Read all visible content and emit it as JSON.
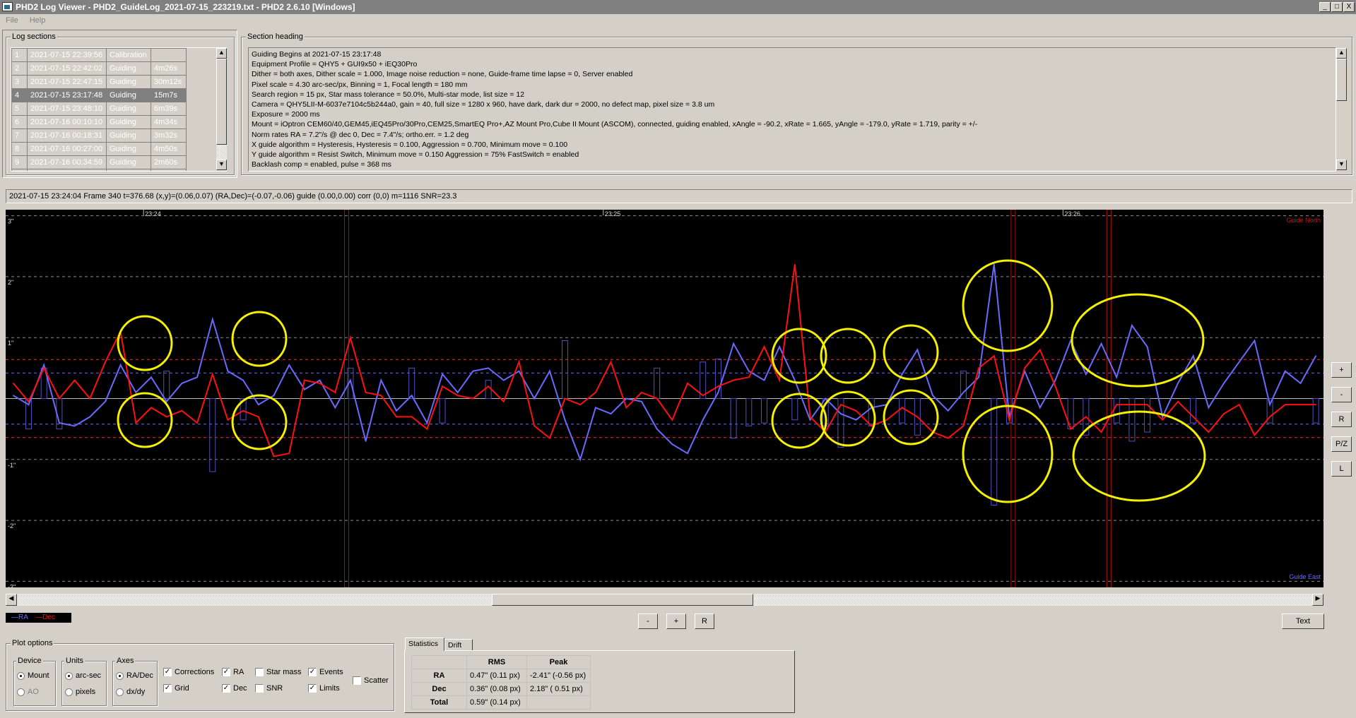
{
  "window": {
    "title": "PHD2 Log Viewer - PHD2_GuideLog_2021-07-15_223219.txt - PHD2 2.6.10 [Windows]",
    "controls": [
      "_",
      "□",
      "X"
    ]
  },
  "menu": [
    "File",
    "Help"
  ],
  "log_sections": {
    "label": "Log sections",
    "selected_index": 3,
    "rows": [
      [
        "1",
        "2021-07-15 22:39:56",
        "Calibration",
        ""
      ],
      [
        "2",
        "2021-07-15 22:42:02",
        "Guiding",
        "4m26s"
      ],
      [
        "3",
        "2021-07-15 22:47:15",
        "Guiding",
        "30m12s"
      ],
      [
        "4",
        "2021-07-15 23:17:48",
        "Guiding",
        "15m7s"
      ],
      [
        "5",
        "2021-07-15 23:48:10",
        "Guiding",
        "6m39s"
      ],
      [
        "6",
        "2021-07-16 00:10:10",
        "Guiding",
        "4m34s"
      ],
      [
        "7",
        "2021-07-16 00:18:31",
        "Guiding",
        "3m32s"
      ],
      [
        "8",
        "2021-07-16 00:27:00",
        "Guiding",
        "4m50s"
      ],
      [
        "9",
        "2021-07-16 00:34:59",
        "Guiding",
        "2m60s"
      ]
    ]
  },
  "section_heading": {
    "label": "Section heading",
    "lines": [
      "Guiding Begins at 2021-07-15 23:17:48",
      "Equipment Profile = QHY5 + GUI9x50 + iEQ30Pro",
      "Dither = both axes, Dither scale = 1.000, Image noise reduction = none, Guide-frame time lapse = 0, Server enabled",
      "Pixel scale = 4.30 arc-sec/px, Binning = 1, Focal length = 180 mm",
      "Search region = 15 px, Star mass tolerance = 50.0%, Multi-star mode, list size = 12",
      " Camera = QHY5LII-M-6037e7104c5b244a0, gain = 40, full size = 1280 x 960, have dark, dark dur = 2000, no defect map, pixel size = 3.8 um",
      "Exposure = 2000 ms",
      "Mount = iOptron CEM60/40,GEM45,iEQ45Pro/30Pro,CEM25,SmartEQ Pro+,AZ Mount Pro,Cube II Mount (ASCOM), connected, guiding enabled, xAngle = -90.2, xRate = 1.665, yAngle = -179.0, yRate = 1.719, parity = +/-",
      "Norm rates RA = 7.2\"/s @ dec 0, Dec = 7.4\"/s; ortho.err. = 1.2 deg",
      "X guide algorithm = Hysteresis, Hysteresis = 0.100, Aggression = 0.700, Minimum move = 0.100",
      "Y guide algorithm = Resist Switch, Minimum move = 0.150 Aggression = 75% FastSwitch = enabled",
      "Backlash comp = enabled, pulse = 368 ms"
    ]
  },
  "status_line": "2021-07-15 23:24:04 Frame 340 t=376.68 (x,y)=(0.06,0.07) (RA,Dec)=(-0.07,-0.06) guide (0.00,0.00) corr (0,0) m=1116 SNR=23.3",
  "chart_data": {
    "type": "line",
    "xlim": [
      "23:23:42",
      "23:26:34"
    ],
    "ylim": [
      -3.1,
      3.1
    ],
    "y_ticks": [
      "3\"",
      "2\"",
      "1\"",
      "0",
      "-1\"",
      "-2\"",
      "-3\""
    ],
    "y_tick_values": [
      3,
      2,
      1,
      0,
      -1,
      -2,
      -3
    ],
    "x_ticks": [
      "23:24",
      "23:25",
      "23:26"
    ],
    "grid": true,
    "top_label": "Guide North",
    "bottom_label": "Guide East",
    "legend": {
      "placement": "bottom-left",
      "entries": [
        "RA",
        "Dec"
      ]
    },
    "limits": {
      "ra": 0.42,
      "dec": 0.64
    },
    "events": [
      "23:24:26.5",
      "23:25:53.5",
      "23:26:06"
    ],
    "sample_interval_note_free": true,
    "x": [
      "23:23:43",
      "23:23:45",
      "23:23:47",
      "23:23:49",
      "23:23:51",
      "23:23:53",
      "23:23:55",
      "23:23:57",
      "23:23:59",
      "23:24:01",
      "23:24:03",
      "23:24:05",
      "23:24:07",
      "23:24:09",
      "23:24:11",
      "23:24:13",
      "23:24:15",
      "23:24:17",
      "23:24:19",
      "23:24:21",
      "23:24:23",
      "23:24:25",
      "23:24:27",
      "23:24:29",
      "23:24:31",
      "23:24:33",
      "23:24:35",
      "23:24:37",
      "23:24:39",
      "23:24:41",
      "23:24:43",
      "23:24:45",
      "23:24:47",
      "23:24:49",
      "23:24:51",
      "23:24:53",
      "23:24:55",
      "23:24:57",
      "23:24:59",
      "23:25:01",
      "23:25:03",
      "23:25:05",
      "23:25:07",
      "23:25:09",
      "23:25:11",
      "23:25:13",
      "23:25:15",
      "23:25:17",
      "23:25:19",
      "23:25:21",
      "23:25:23",
      "23:25:25",
      "23:25:27",
      "23:25:29",
      "23:25:31",
      "23:25:33",
      "23:25:35",
      "23:25:37",
      "23:25:39",
      "23:25:41",
      "23:25:43",
      "23:25:45",
      "23:25:47",
      "23:25:49",
      "23:25:51",
      "23:25:53",
      "23:25:55",
      "23:25:57",
      "23:25:59",
      "23:26:01",
      "23:26:03",
      "23:26:05",
      "23:26:07",
      "23:26:09",
      "23:26:11",
      "23:26:13",
      "23:26:15",
      "23:26:17",
      "23:26:19",
      "23:26:21",
      "23:26:23",
      "23:26:25",
      "23:26:27",
      "23:26:29",
      "23:26:31",
      "23:26:33"
    ],
    "series": [
      {
        "name": "RA",
        "color": "#6a6aff",
        "values": [
          0.05,
          -0.1,
          0.55,
          -0.4,
          -0.45,
          -0.3,
          -0.05,
          0.55,
          0.1,
          0.35,
          -0.05,
          0.25,
          0.35,
          1.3,
          0.45,
          0.3,
          -0.1,
          0.05,
          0.55,
          0.15,
          0.3,
          -0.15,
          0.3,
          -0.7,
          0.3,
          -0.2,
          0.05,
          -0.4,
          0.4,
          0.1,
          0.45,
          0.5,
          0.3,
          0.45,
          0.0,
          0.45,
          -0.35,
          -1.0,
          -0.15,
          -0.25,
          0.0,
          -0.05,
          -0.5,
          -0.75,
          -0.9,
          -0.35,
          0.1,
          0.9,
          0.45,
          0.3,
          0.85,
          0.3,
          -0.35,
          0.0,
          -0.25,
          -0.35,
          -0.15,
          -0.1,
          0.4,
          0.8,
          0.05,
          -0.2,
          0.1,
          0.35,
          2.2,
          -0.3,
          0.45,
          -0.15,
          0.3,
          0.95,
          0.4,
          0.9,
          0.35,
          1.2,
          0.85,
          -0.3,
          0.25,
          0.7,
          -0.15,
          0.25,
          0.6,
          0.95,
          -0.1,
          0.45,
          0.25,
          0.7
        ]
      },
      {
        "name": "Dec",
        "color": "#ff1010",
        "values": [
          0.25,
          -0.05,
          0.5,
          0.0,
          0.3,
          0.0,
          0.6,
          1.1,
          -0.4,
          -0.15,
          -0.3,
          -0.2,
          -0.4,
          0.4,
          -0.35,
          -0.2,
          -0.3,
          -0.95,
          -0.9,
          0.3,
          0.25,
          0.1,
          1.0,
          0.1,
          0.05,
          -0.3,
          -0.3,
          -0.5,
          0.2,
          0.05,
          0.0,
          0.2,
          -0.05,
          0.6,
          -0.45,
          -0.65,
          0.0,
          -0.1,
          0.1,
          0.6,
          -0.15,
          0.1,
          0.0,
          -0.35,
          0.25,
          0.05,
          0.2,
          0.3,
          0.35,
          0.85,
          0.3,
          2.2,
          -0.3,
          -0.55,
          -0.1,
          -0.2,
          -0.45,
          -0.35,
          -0.15,
          -0.3,
          -0.55,
          -0.65,
          -0.45,
          0.5,
          0.7,
          -0.35,
          0.5,
          0.8,
          0.2,
          -0.5,
          -0.3,
          -0.55,
          -0.1,
          -0.1,
          -0.1,
          -0.35,
          -0.05,
          -0.3,
          -0.55,
          -0.25,
          -0.1,
          -0.6,
          -0.3,
          -0.1,
          -0.1,
          -0.1
        ]
      }
    ],
    "ra_corrections": [
      0,
      -0.5,
      0.5,
      -0.5,
      0,
      0,
      0,
      0,
      0,
      0,
      0.45,
      0,
      0,
      -1.2,
      0,
      -0.35,
      0,
      0,
      0,
      0,
      0,
      0,
      0.5,
      0,
      0,
      0,
      0.5,
      0,
      -0.4,
      0,
      0,
      0.3,
      0,
      0,
      0,
      0,
      0.95,
      0,
      0,
      0,
      0,
      0,
      0.5,
      0,
      0,
      0.6,
      0.65,
      -0.65,
      -0.45,
      -0.4,
      0,
      -0.35,
      0,
      -0.45,
      -0.8,
      0,
      -0.45,
      0,
      -0.4,
      -0.6,
      0,
      0,
      0.45,
      0,
      -1.75,
      -0.4,
      0,
      0,
      0,
      -0.5,
      -0.6,
      0,
      -0.4,
      -0.7,
      -0.55,
      0,
      0,
      -0.4,
      0,
      0,
      0,
      0,
      -0.4,
      0,
      0,
      -0.4
    ]
  },
  "legend_labels": {
    "ra": "—RA",
    "dec": "—Dec"
  },
  "chart_side_buttons": [
    "+",
    "-",
    "R",
    "P/Z",
    "L"
  ],
  "zoom_buttons": [
    "-",
    "+",
    "R"
  ],
  "text_button": "Text",
  "plot_options": {
    "label": "Plot options",
    "device": {
      "label": "Device",
      "options": [
        "Mount",
        "AO"
      ],
      "selected": "Mount"
    },
    "units": {
      "label": "Units",
      "options": [
        "arc-sec",
        "pixels"
      ],
      "selected": "arc-sec"
    },
    "axes": {
      "label": "Axes",
      "options": [
        "RA/Dec",
        "dx/dy"
      ],
      "selected": "RA/Dec"
    },
    "checks": {
      "corrections": {
        "label": "Corrections",
        "checked": true
      },
      "grid": {
        "label": "Grid",
        "checked": true
      },
      "ra": {
        "label": "RA",
        "checked": true
      },
      "dec": {
        "label": "Dec",
        "checked": true
      },
      "star_mass": {
        "label": "Star mass",
        "checked": false
      },
      "snr": {
        "label": "SNR",
        "checked": false
      },
      "events": {
        "label": "Events",
        "checked": true
      },
      "limits": {
        "label": "Limits",
        "checked": true
      },
      "scatter": {
        "label": "Scatter",
        "checked": false
      }
    }
  },
  "stats": {
    "tabs": [
      "Statistics",
      "Drift"
    ],
    "active_tab": "Statistics",
    "headers": [
      "",
      "RMS",
      "Peak"
    ],
    "rows": [
      [
        "RA",
        "0.47\" (0.11 px)",
        "-2.41\" (-0.56 px)"
      ],
      [
        "Dec",
        "0.36\" (0.08 px)",
        "2.18\" ( 0.51 px)"
      ],
      [
        "Total",
        "0.59\" (0.14 px)",
        ""
      ]
    ]
  }
}
